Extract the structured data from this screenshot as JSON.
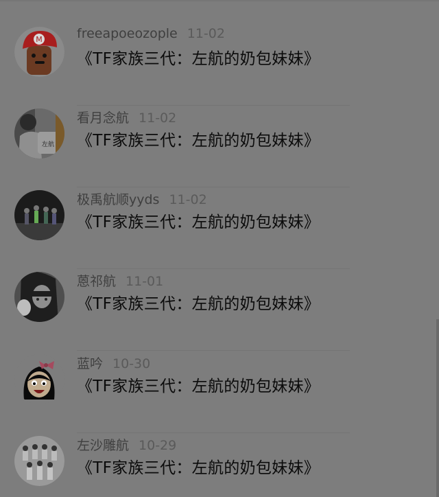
{
  "comments": [
    {
      "username": "freeapoeozople",
      "time": "11-02",
      "text": "《TF家族三代：左航的奶包妹妹》",
      "avatar": "mario-hat-avatar-icon"
    },
    {
      "username": "看月念航",
      "time": "11-02",
      "text": "《TF家族三代：左航的奶包妹妹》",
      "avatar": "person-photo-avatar-icon"
    },
    {
      "username": "极禹航顺yyds",
      "time": "11-02",
      "text": "《TF家族三代：左航的奶包妹妹》",
      "avatar": "group-photo-avatar-icon"
    },
    {
      "username": "蒽祁航",
      "time": "11-01",
      "text": "《TF家族三代：左航的奶包妹妹》",
      "avatar": "portrait-avatar-icon"
    },
    {
      "username": "蓝吟",
      "time": "10-30",
      "text": "《TF家族三代：左航的奶包妹妹》",
      "avatar": "cartoon-girl-avatar-icon"
    },
    {
      "username": "左沙雕航",
      "time": "10-29",
      "text": "《TF家族三代：左航的奶包妹妹》",
      "avatar": "group-white-avatar-icon"
    }
  ]
}
